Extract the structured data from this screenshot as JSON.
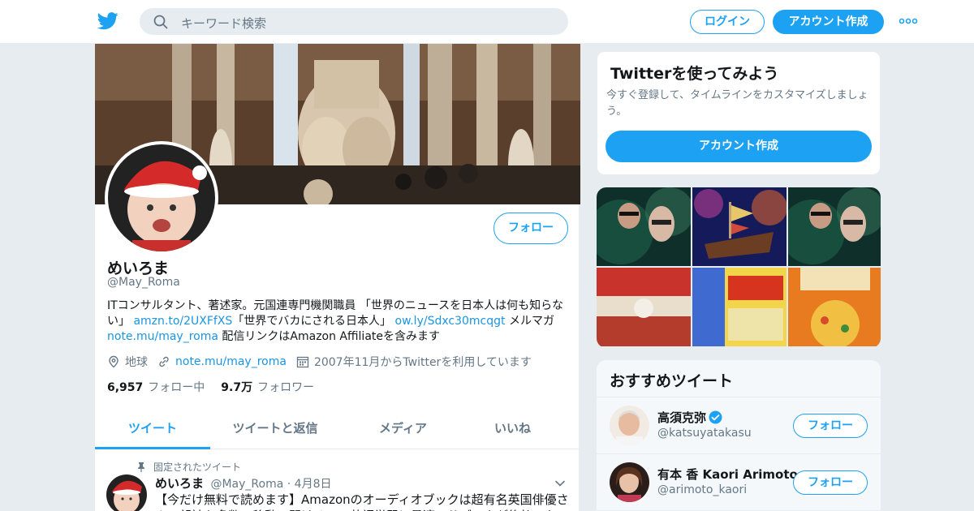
{
  "nav": {
    "search_placeholder": "キーワード検索",
    "login_label": "ログイン",
    "signup_label": "アカウント作成"
  },
  "profile": {
    "name": "めいろま",
    "handle": "@May_Roma",
    "follow_label": "フォロー",
    "bio": {
      "part1": "ITコンサルタント、著述家。元国連専門機関職員 「世界のニュースを日本人は何も知らない」 ",
      "link1": "amzn.to/2UXFfXS",
      "part2": "「世界でバカにされる日本人」 ",
      "link2": "ow.ly/Sdxc30mcqgt",
      "part3": " メルマガ ",
      "link3": "note.mu/may_roma",
      "part4": " 配信リンクはAmazon Affiliateを含みます"
    },
    "location": "地球",
    "website": "note.mu/may_roma",
    "joined": "2007年11月からTwitterを利用しています",
    "following_count": "6,957",
    "following_label": "フォロー中",
    "followers_count": "9.7万",
    "followers_label": "フォロワー"
  },
  "tabs": [
    {
      "label": "ツイート"
    },
    {
      "label": "ツイートと返信"
    },
    {
      "label": "メディア"
    },
    {
      "label": "いいね"
    }
  ],
  "pinned_tweet": {
    "pinned_label": "固定されたツイート",
    "author_name": "めいろま",
    "author_handle": "@May_Roma",
    "separator": "·",
    "date": "4月8日",
    "text": "【今だけ無料で読めます】Amazonのオーディオブックは超有名英国俳優さんの朗読も多数。移動で聞けるので英語学習に最適。サブスクが後払いな"
  },
  "signup_card": {
    "title": "Twitterを使ってみよう",
    "description": "今すぐ登録して、タイムラインをカスタマイズしましょう。",
    "button_label": "アカウント作成"
  },
  "recommended": {
    "title": "おすすめツイート",
    "users": [
      {
        "name": "高須克弥",
        "handle": "@katsuyatakasu",
        "verified": true,
        "button": "フォロー"
      },
      {
        "name": "有本 香 Kaori Arimoto",
        "handle": "@arimoto_kaori",
        "verified": false,
        "button": "フォロー"
      }
    ]
  },
  "colors": {
    "brand": "#1da1f2",
    "link": "#1b95e0",
    "text_secondary": "#657786",
    "border": "#e6ecf0"
  },
  "icons": [
    "twitter-logo-icon",
    "search-icon",
    "more-dots-icon",
    "location-icon",
    "link-icon",
    "calendar-icon",
    "pin-icon",
    "chevron-down-icon",
    "verified-icon"
  ]
}
